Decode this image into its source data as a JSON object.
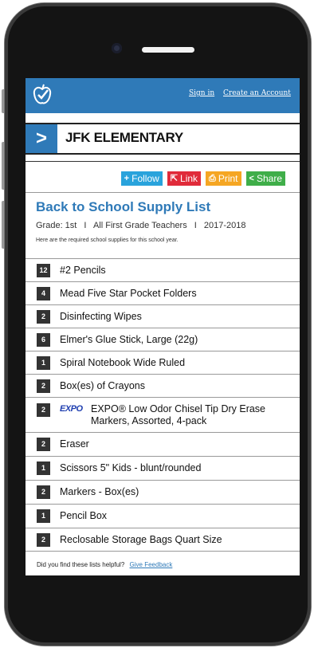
{
  "header": {
    "signin_label": "Sign in",
    "create_account_label": "Create an Account",
    "brand_color": "#2f7ab8"
  },
  "school": {
    "arrow": ">",
    "name": "JFK ELEMENTARY"
  },
  "actions": [
    {
      "label": "Follow",
      "icon": "+",
      "color": "#29a3dc"
    },
    {
      "label": "Link",
      "icon": "⇱",
      "color": "#e02b3a"
    },
    {
      "label": "Print",
      "icon": "⎙",
      "color": "#f5a623"
    },
    {
      "label": "Share",
      "icon": "<",
      "color": "#3fae49"
    }
  ],
  "list": {
    "title": "Back to School Supply List",
    "grade": "Grade: 1st",
    "sep1": "I",
    "teachers": "All First Grade Teachers",
    "sep2": "I",
    "year": "2017-2018",
    "note": "Here are the required school supplies for this school year."
  },
  "items": [
    {
      "qty": "12",
      "name": "#2 Pencils"
    },
    {
      "qty": "4",
      "name": "Mead Five Star Pocket Folders"
    },
    {
      "qty": "2",
      "name": "Disinfecting Wipes"
    },
    {
      "qty": "6",
      "name": "Elmer's Glue Stick, Large (22g)"
    },
    {
      "qty": "1",
      "name": "Spiral Notebook Wide Ruled"
    },
    {
      "qty": "2",
      "name": "Box(es) of Crayons"
    },
    {
      "qty": "2",
      "name": "EXPO® Low Odor Chisel Tip Dry Erase Markers, Assorted, 4-pack",
      "brand_logo": "EXPO"
    },
    {
      "qty": "2",
      "name": "Eraser"
    },
    {
      "qty": "1",
      "name": "Scissors 5\" Kids - blunt/rounded"
    },
    {
      "qty": "2",
      "name": "Markers - Box(es)"
    },
    {
      "qty": "1",
      "name": "Pencil Box"
    },
    {
      "qty": "2",
      "name": "Reclosable Storage Bags Quart Size"
    }
  ],
  "footer": {
    "question": "Did you find these lists helpful?",
    "feedback_label": "Give Feedback"
  }
}
